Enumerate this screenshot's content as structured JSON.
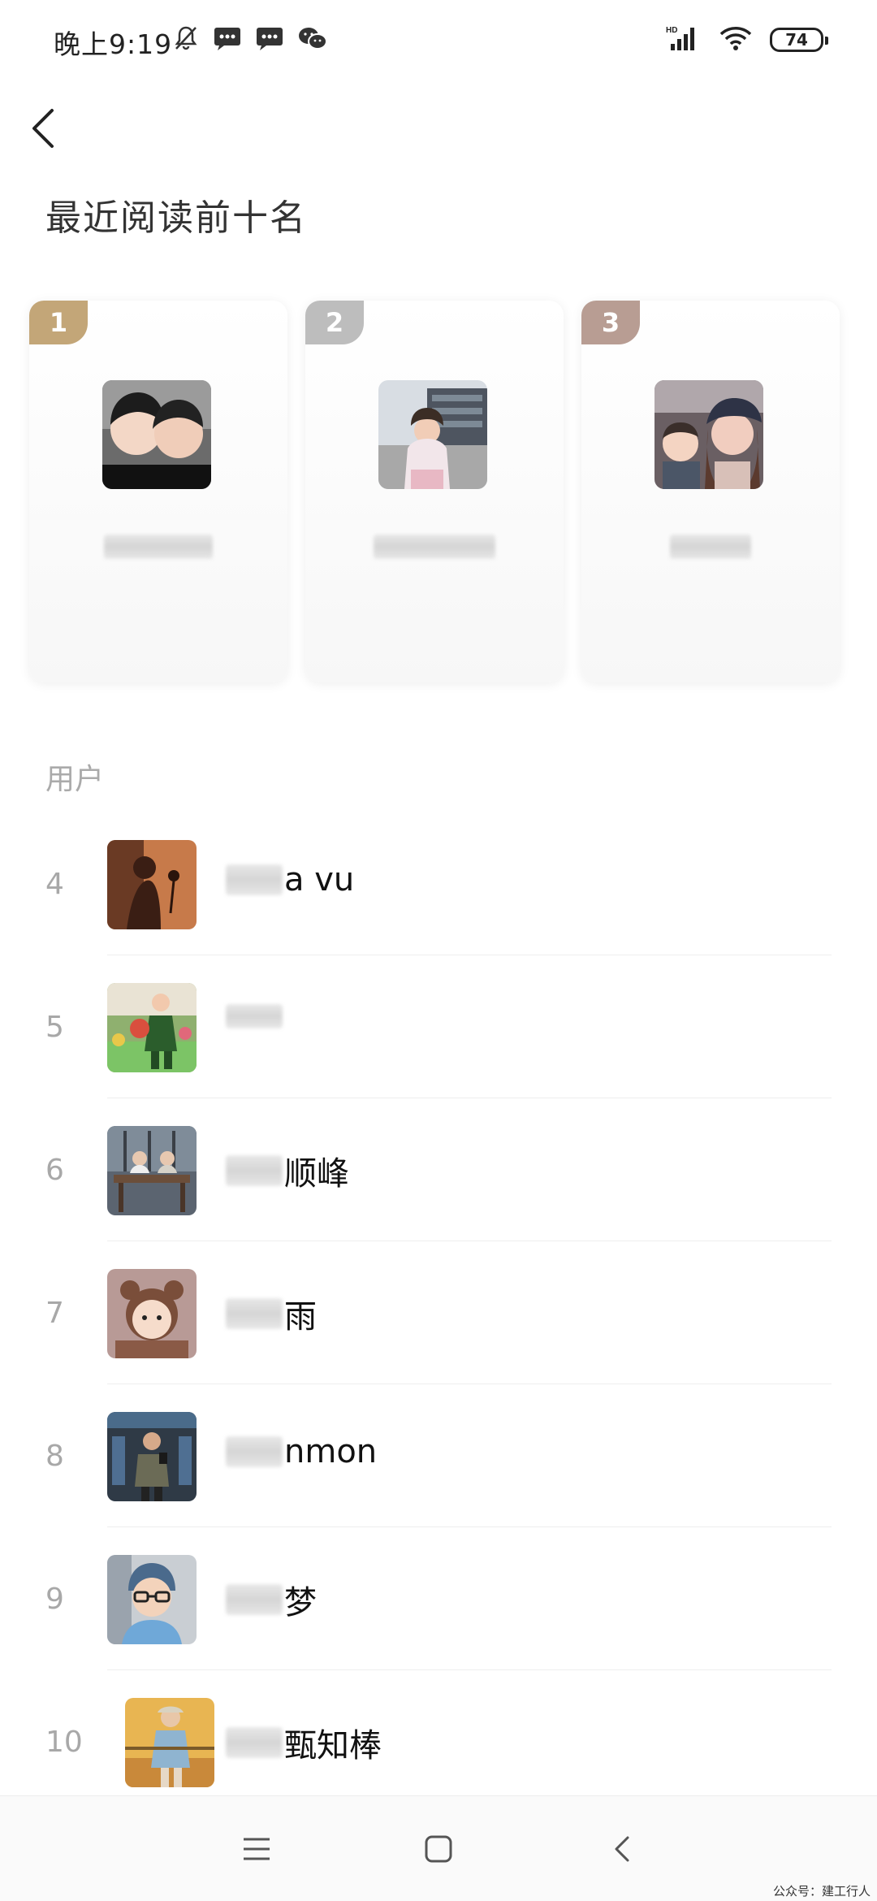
{
  "status_bar": {
    "time": "晚上9:19",
    "battery": "74",
    "network": "HD"
  },
  "header": {
    "title": "最近阅读前十名"
  },
  "top_cards": [
    {
      "rank": "1",
      "badge_color": "#c3a678"
    },
    {
      "rank": "2",
      "badge_color": "#bdbdbd"
    },
    {
      "rank": "3",
      "badge_color": "#b89d93"
    }
  ],
  "section": {
    "label": "用户"
  },
  "users": [
    {
      "rank": "4",
      "name_suffix": "a vu"
    },
    {
      "rank": "5",
      "name_suffix": ""
    },
    {
      "rank": "6",
      "name_suffix": "顺峰"
    },
    {
      "rank": "7",
      "name_suffix": "雨"
    },
    {
      "rank": "8",
      "name_suffix": "nmon"
    },
    {
      "rank": "9",
      "name_suffix": "梦"
    },
    {
      "rank": "10",
      "name_suffix": "甄知棒"
    }
  ],
  "nav": {
    "icons": [
      "menu-icon",
      "home-square-icon",
      "back-icon"
    ]
  },
  "watermark": "公众号：建工行人"
}
